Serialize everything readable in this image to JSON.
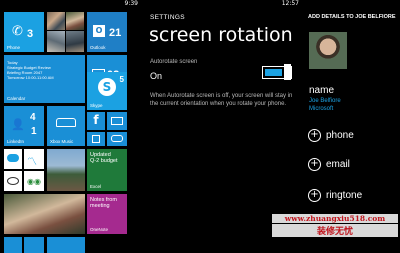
{
  "start_screen": {
    "time": "9:39",
    "tiles": {
      "phone": {
        "count": "3",
        "label": "Phone"
      },
      "outlook": {
        "count": "21",
        "label": "Outlook"
      },
      "calendar": {
        "line1": "Today",
        "line2": "Strategic Budget Review",
        "line3": "Briefing Room 2047",
        "line4": "Tomorrow 10:00-11:00 AM",
        "label": "Calendar"
      },
      "messaging": {
        "count": "02",
        "label": "Messaging",
        "icon": "chat-icon"
      },
      "skype": {
        "count": "5",
        "label": "Skype",
        "icon": "skype-icon"
      },
      "linkedin": {
        "count": "4",
        "label": "LinkedIn"
      },
      "people": {
        "count": "1"
      },
      "xbox_music": {
        "label": "Xbox Music",
        "icon": "car-icon"
      },
      "facebook": {
        "label": "f"
      },
      "excel_tile": {
        "line1": "Updated",
        "line2": "Q-2 budget",
        "label": "Excel"
      },
      "onenote_tile": {
        "line1": "Notes from",
        "line2": "meeting",
        "label": "OneNote"
      }
    }
  },
  "settings": {
    "time": "12:57",
    "header": "SETTINGS",
    "title": "screen rotation",
    "setting_label": "Autorotate screen",
    "setting_value": "On",
    "description": "When Autorotate screen is off, your screen will stay in the current orientation when you rotate your phone.",
    "toggle_state": 1
  },
  "contact": {
    "header": "ADD DETAILS TO JOE BELFIORE",
    "name_label": "name",
    "first_last": "Joe Belfiore",
    "company": "Microsoft",
    "actions": [
      {
        "label": "phone"
      },
      {
        "label": "email"
      },
      {
        "label": "ringtone"
      }
    ]
  },
  "watermark": {
    "url": "www.zhuangxiu518.com",
    "brand": "装修无忧"
  },
  "colors": {
    "accent": "#1ba1e2",
    "background": "#000000",
    "watermark": "#c0151d"
  }
}
